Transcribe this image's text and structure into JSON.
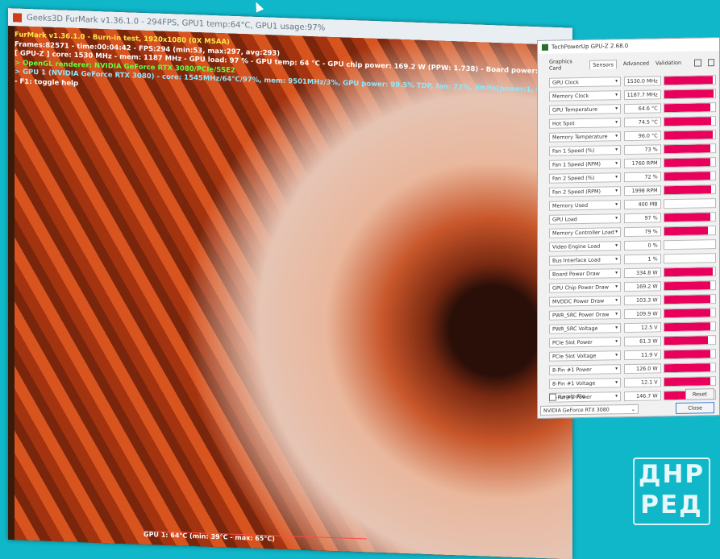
{
  "furmark": {
    "title": "Geeks3D FurMark v1.36.1.0 - 294FPS, GPU1 temp:64°C, GPU1 usage:97%",
    "overlay": [
      {
        "text": "FurMark v1.36.1.0 - Burn-in test, 1920x1080 (0X MSAA)",
        "color": "yl"
      },
      {
        "text": "Frames:82571 - time:00:04:42 - FPS:294 (min:53, max:297, avg:293)",
        "color": "wh"
      },
      {
        "text": "[ GPU-Z ] core: 1530 MHz - mem: 1187 MHz - GPU load: 97 % - GPU temp: 64 °C - GPU chip power: 169.2 W (PPW: 1.738) - Board power: 334.8 W (PPW: 0.878) - GPU voltage: 0.906 V",
        "color": "wh"
      },
      {
        "text": "> OpenGL renderer: NVIDIA GeForce RTX 3080/PCIe/SSE2",
        "color": "gr"
      },
      {
        "text": "> GPU 1 (NVIDIA GeForce RTX 3080) - core: 1545MHz/64°C/97%, mem: 9501MHz/3%, GPU power: 99.5% TDP, fan: 73%, limits[power:1, temp:0, volt:0, OV:0]",
        "color": "cy"
      },
      {
        "text": "- F1: toggle help",
        "color": "wh"
      }
    ],
    "footer": "GPU 1: 64°C (min: 39°C - max: 65°C)"
  },
  "gpuz": {
    "title": "TechPowerUp GPU-Z 2.68.0",
    "tabs": [
      "Graphics Card",
      "Sensors",
      "Advanced",
      "Validation"
    ],
    "active_tab": "Sensors",
    "sensors": [
      {
        "label": "GPU Clock",
        "value": "1530.0 MHz",
        "level": 0.95
      },
      {
        "label": "Memory Clock",
        "value": "1187.7 MHz",
        "level": 0.97
      },
      {
        "label": "GPU Temperature",
        "value": "64.6 °C",
        "level": 0.9
      },
      {
        "label": "Hot Spot",
        "value": "74.5 °C",
        "level": 0.92
      },
      {
        "label": "Memory Temperature",
        "value": "96.0 °C",
        "level": 0.95
      },
      {
        "label": "Fan 1 Speed (%)",
        "value": "73 %",
        "level": 0.9
      },
      {
        "label": "Fan 1 Speed (RPM)",
        "value": "1760 RPM",
        "level": 0.9
      },
      {
        "label": "Fan 2 Speed (%)",
        "value": "72 %",
        "level": 0.9
      },
      {
        "label": "Fan 2 Speed (RPM)",
        "value": "1998 RPM",
        "level": 0.92
      },
      {
        "label": "Memory Used",
        "value": "400 MB",
        "level": 0
      },
      {
        "label": "GPU Load",
        "value": "97 %",
        "level": 0.9
      },
      {
        "label": "Memory Controller Load",
        "value": "79 %",
        "level": 0.85
      },
      {
        "label": "Video Engine Load",
        "value": "0 %",
        "level": 0
      },
      {
        "label": "Bus Interface Load",
        "value": "1 %",
        "level": 0
      },
      {
        "label": "Board Power Draw",
        "value": "334.8 W",
        "level": 0.95
      },
      {
        "label": "GPU Chip Power Draw",
        "value": "169.2 W",
        "level": 0.9
      },
      {
        "label": "MVDDC Power Draw",
        "value": "103.3 W",
        "level": 0.9
      },
      {
        "label": "PWR_SRC Power Draw",
        "value": "109.9 W",
        "level": 0.9
      },
      {
        "label": "PWR_SRC Voltage",
        "value": "12.5 V",
        "level": 0.9
      },
      {
        "label": "PCIe Slot Power",
        "value": "61.3 W",
        "level": 0.85
      },
      {
        "label": "PCIe Slot Voltage",
        "value": "11.9 V",
        "level": 0.9
      },
      {
        "label": "8-Pin #1 Power",
        "value": "126.0 W",
        "level": 0.9
      },
      {
        "label": "8-Pin #1 Voltage",
        "value": "12.1 V",
        "level": 0.9
      },
      {
        "label": "8-Pin #2 Power",
        "value": "146.7 W",
        "level": 0.92
      }
    ],
    "log_to_file": "Log to file",
    "reset": "Reset",
    "card_selected": "NVIDIA GeForce RTX 3080",
    "close": "Close",
    "graph_color": "#e8005a"
  },
  "logo": {
    "line1": "ДНР",
    "line2": "РЕД"
  }
}
